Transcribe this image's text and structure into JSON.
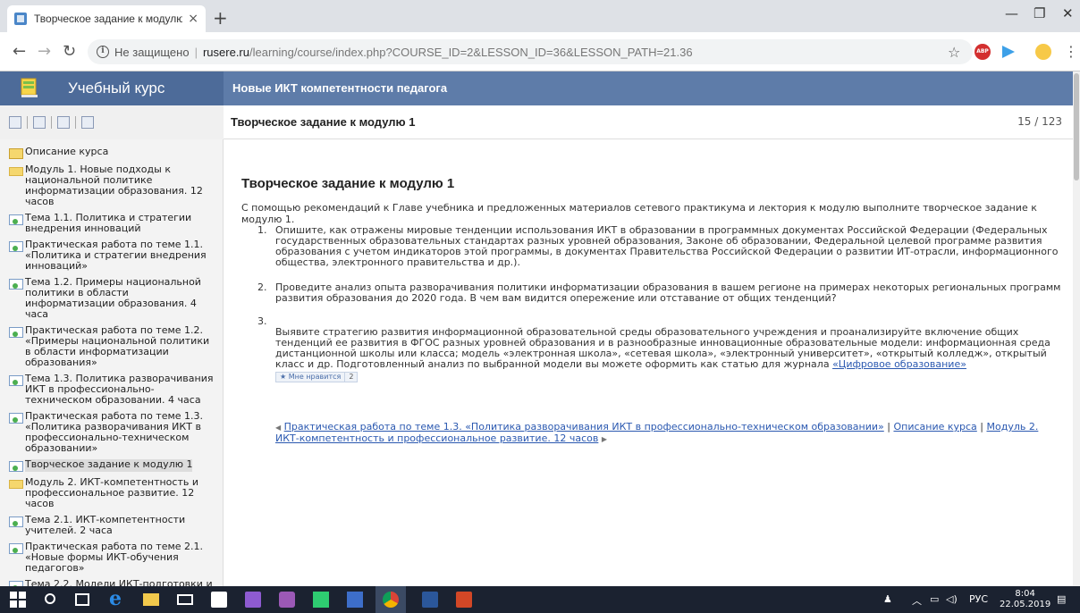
{
  "browser": {
    "tab_title": "Творческое задание к модулю",
    "tab_close": "×",
    "new_tab": "+",
    "not_secure": "Не защищено",
    "url_host": "rusere.ru",
    "url_path": "/learning/course/index.php?COURSE_ID=2&LESSON_ID=36&LESSON_PATH=21.36",
    "abp_label": "ABP"
  },
  "site": {
    "title": "Учебный курс",
    "course_name": "Новые ИКТ компетентности педагога"
  },
  "lesson": {
    "header": "Творческое задание к модулю 1",
    "counter": "15 / 123",
    "heading": "Творческое задание к модулю 1",
    "intro": "С помощью рекомендаций к Главе учебника и предложенных материалов сетевого практикума и лектория к модулю выполните творческое задание к модулю 1.",
    "tasks": [
      {
        "num": "1.",
        "text": "Опишите, как отражены мировые тенденции использования ИКТ в образовании в программных документах Российской Федерации (Федеральных государственных образовательных стандартах разных уровней образования, Законе об образовании, Федеральной целевой программе развития образования с учетом индикаторов этой программы, в документах Правительства Российской Федерации о развитии ИТ-отрасли, информационного общества, электронного правительства и др.)."
      },
      {
        "num": "2.",
        "text": "Проведите анализ опыта разворачивания политики информатизации образования в вашем регионе на примерах некоторых региональных программ развития образования до 2020 года. В чем вам видится опережение или отставание от общих тенденций?"
      },
      {
        "num": "3.",
        "text": "Выявите стратегию развития информационной образовательной среды образовательного учреждения и проанализируйте включение общих тенденций ее развития в ФГОС разных уровней образования и в разнообразные инновационные образовательные модели: информационная среда дистанционной школы или класса; модель «электронная школа», «сетевая школа», «электронный университет», «открытый колледж», открытый класс и др. Подготовленный анализ по выбранной модели вы можете оформить как статью для журнала ",
        "link": "«Цифровое образование»"
      }
    ],
    "like_label": "★ Мне нравится",
    "like_count": "2",
    "nav": {
      "prev": "Практическая работа по теме 1.3. «Политика разворачивания ИКТ в профессионально-техническом образовании»",
      "sep": " | ",
      "toc": "Описание курса",
      "next": "Модуль 2. ИКТ-компетентность и профессиональное развитие. 12 часов"
    }
  },
  "sidebar": {
    "items": [
      {
        "label": "Описание курса",
        "icon": "page"
      },
      {
        "label": "Модуль 1. Новые подходы к национальной политике информатизации образования. 12 часов",
        "icon": "folder"
      },
      {
        "label": "Тема 1.1. Политика и стратегии внедрения инноваций",
        "icon": "doc"
      },
      {
        "label": "Практическая работа по теме 1.1. «Политика и стратегии внедрения инноваций»",
        "icon": "doc"
      },
      {
        "label": "Тема 1.2. Примеры национальной политики в области информатизации образования. 4 часа",
        "icon": "doc"
      },
      {
        "label": "Практическая работа по теме 1.2. «Примеры национальной политики в области информатизации образования»",
        "icon": "doc"
      },
      {
        "label": "Тема 1.3. Политика разворачивания ИКТ в профессионально-техническом образовании. 4 часа",
        "icon": "doc"
      },
      {
        "label": "Практическая работа по теме 1.3. «Политика разворачивания ИКТ в профессионально-техническом образовании»",
        "icon": "doc"
      },
      {
        "label": "Творческое задание к модулю 1",
        "icon": "doc"
      },
      {
        "label": "Модуль 2. ИКТ-компетентность и профессиональное развитие. 12 часов",
        "icon": "folder"
      },
      {
        "label": "Тема 2.1. ИКТ-компетентности учителей. 2 часа",
        "icon": "doc"
      },
      {
        "label": "Практическая работа по теме 2.1. «Новые формы ИКТ-обучения педагогов»",
        "icon": "doc"
      },
      {
        "label": "Тема 2.2. Модели ИКТ-подготовки и",
        "icon": "doc"
      }
    ]
  },
  "taskbar": {
    "lang": "РУС",
    "time": "8:04",
    "date": "22.05.2019",
    "user_glyph": "ℛ"
  }
}
